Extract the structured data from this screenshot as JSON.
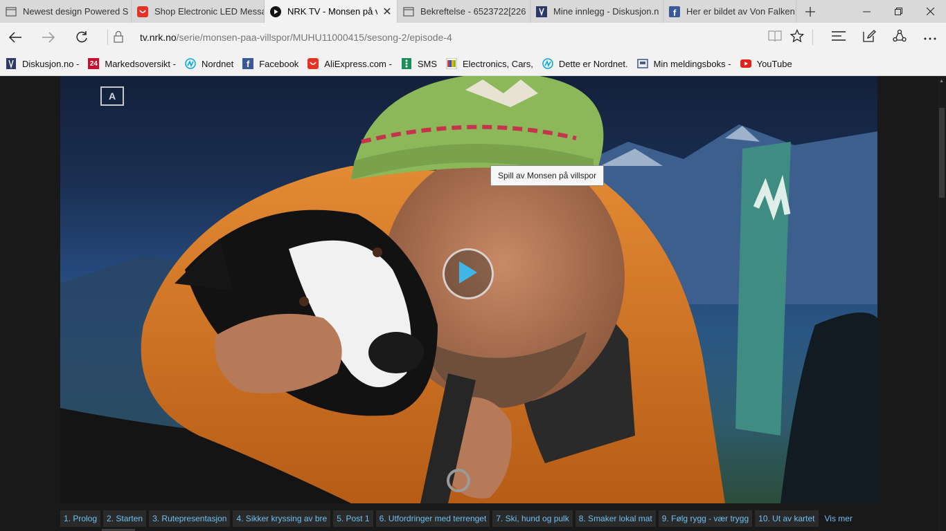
{
  "tabs": [
    {
      "title": "Newest design Powered S",
      "icon": "page-icon",
      "active": false
    },
    {
      "title": "Shop Electronic LED Messa",
      "icon": "aliexpress-icon",
      "active": false
    },
    {
      "title": "NRK TV - Monsen på v",
      "icon": "play-circle-icon",
      "active": true
    },
    {
      "title": "Bekreftelse - 6523722[226",
      "icon": "page-icon",
      "active": false
    },
    {
      "title": "Mine innlegg - Diskusjon.n",
      "icon": "diskusjon-icon",
      "active": false
    },
    {
      "title": "Her er bildet av Von Falken",
      "icon": "facebook-icon",
      "active": false
    }
  ],
  "address": {
    "host": "tv.nrk.no",
    "path": "/serie/monsen-paa-villspor/MUHU11000415/sesong-2/episode-4"
  },
  "favorites": [
    {
      "label": "Diskusjon.no -",
      "icon": "diskusjon-icon",
      "color": "#2b3a67"
    },
    {
      "label": "Markedsoversikt -",
      "icon": "24-icon",
      "color": "#c8102e",
      "glyph": "24"
    },
    {
      "label": "Nordnet",
      "icon": "nordnet-icon",
      "color": "#00a9e0"
    },
    {
      "label": "Facebook",
      "icon": "facebook-icon",
      "color": "#3b5998",
      "glyph": "f"
    },
    {
      "label": "AliExpress.com -",
      "icon": "aliexpress-icon",
      "color": "#e43225"
    },
    {
      "label": "SMS",
      "icon": "sms-icon",
      "color": "#1a8f5a"
    },
    {
      "label": "Electronics, Cars,",
      "icon": "ebay-icon",
      "color": "#86b817"
    },
    {
      "label": "Dette er Nordnet.",
      "icon": "nordnet-icon",
      "color": "#00a9e0"
    },
    {
      "label": "Min meldingsboks -",
      "icon": "inbox-icon",
      "color": "#4a5a8a"
    },
    {
      "label": "YouTube",
      "icon": "youtube-icon",
      "color": "#e62117"
    }
  ],
  "player": {
    "age_badge": "A",
    "tooltip": "Spill av Monsen på villspor"
  },
  "chapters": [
    "1. Prolog",
    "2. Starten",
    "3. Rutepresentasjon",
    "4. Sikker kryssing av bre",
    "5. Post 1",
    "6. Utfordringer med terrenget",
    "7. Ski, hund og pulk",
    "8. Smaker lokal mat",
    "9. Følg rygg - vær trygg",
    "10. Ut av kartet"
  ],
  "chapters_more": "Vis mer",
  "colors": {
    "chapter_text": "#6ec0f2",
    "play_icon": "#3fb5e8",
    "jacket": "#e07a22",
    "hat": "#8cb85a"
  }
}
